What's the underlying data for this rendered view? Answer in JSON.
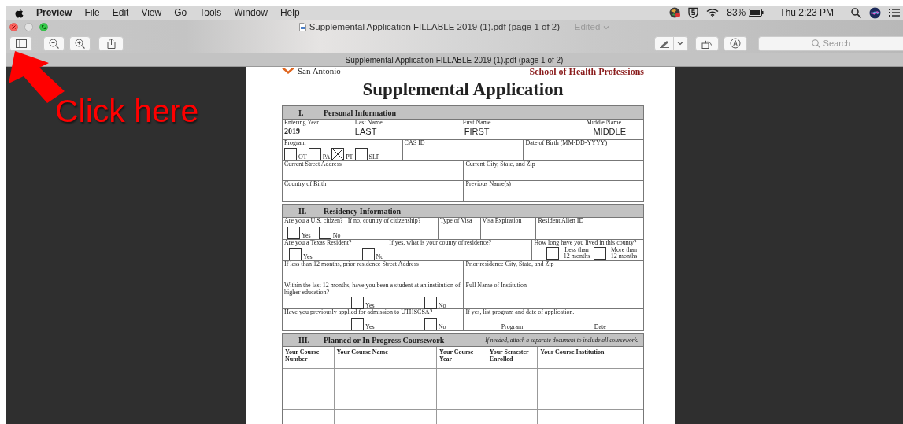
{
  "menu_bar": {
    "app": "Preview",
    "menus": [
      "File",
      "Edit",
      "View",
      "Go",
      "Tools",
      "Window",
      "Help"
    ],
    "battery": "83%",
    "clock": "Thu 2:23 PM"
  },
  "window": {
    "title": "Supplemental Application FILLABLE 2019 (1).pdf (page 1 of 2)",
    "edited": "— Edited",
    "tab_title": "Supplemental Application FILLABLE 2019 (1).pdf (page 1 of 2)"
  },
  "toolbar": {
    "search": {
      "placeholder": "Search"
    }
  },
  "document": {
    "header_left": "San Antonio",
    "header_right": "School of Health Professions",
    "title": "Supplemental Application",
    "sections": [
      {
        "number": "I.",
        "title": "Personal Information",
        "rows": [
          {
            "fields": [
              {
                "label": "Entering Year",
                "value": "2019"
              },
              {
                "label": "Last Name",
                "value": "LAST"
              },
              {
                "label": "First Name",
                "value": "FIRST"
              },
              {
                "label": "Middle Name",
                "value": "MIDDLE"
              }
            ]
          },
          {
            "fields": [
              {
                "label": "Program",
                "options": [
                  {
                    "label": "OT",
                    "checked": false
                  },
                  {
                    "label": "PA",
                    "checked": false
                  },
                  {
                    "label": "PT",
                    "checked": true
                  },
                  {
                    "label": "SLP",
                    "checked": false
                  }
                ]
              },
              {
                "label": "CAS ID"
              },
              {
                "label": "Date of Birth (MM-DD-YYYY)"
              }
            ]
          },
          {
            "fields": [
              {
                "label": "Current Street Address"
              },
              {
                "label": "Current City, State, and Zip"
              }
            ]
          },
          {
            "fields": [
              {
                "label": "Country of Birth"
              },
              {
                "label": "Previous Name(s)"
              }
            ]
          }
        ]
      },
      {
        "number": "II.",
        "title": "Residency Information",
        "rows": [
          {
            "fields": [
              {
                "label": "Are you a U.S. citizen?",
                "options": [
                  {
                    "label": "Yes",
                    "checked": false
                  },
                  {
                    "label": "No",
                    "checked": false
                  }
                ]
              },
              {
                "label": "If no, country of citizenship?"
              },
              {
                "label": "Type of Visa"
              },
              {
                "label": "Visa Expiration"
              },
              {
                "label": "Resident Alien ID"
              }
            ]
          },
          {
            "fields": [
              {
                "label": "Are you a Texas Resident?",
                "options": [
                  {
                    "label": "Yes",
                    "checked": false
                  },
                  {
                    "label": "No",
                    "checked": false
                  }
                ]
              },
              {
                "label": "If yes, what is your county of residence?"
              },
              {
                "label": "How long have you lived in this county?",
                "options": [
                  {
                    "label": "Less than 12 months",
                    "checked": false
                  },
                  {
                    "label": "More than 12 months",
                    "checked": false
                  }
                ]
              }
            ]
          },
          {
            "fields": [
              {
                "label": "If less than 12 months, prior residence Street Address"
              },
              {
                "label": "Prior residence City, State, and Zip"
              }
            ]
          },
          {
            "fields": [
              {
                "label": "Within the last 12 months, have you been a student at an institution of higher education?",
                "options": [
                  {
                    "label": "Yes",
                    "checked": false
                  },
                  {
                    "label": "No",
                    "checked": false
                  }
                ]
              },
              {
                "label": "Full Name of Institution"
              }
            ]
          },
          {
            "fields": [
              {
                "label": "Have you previously applied for admission to UTHSCSA?",
                "options": [
                  {
                    "label": "Yes",
                    "checked": false
                  },
                  {
                    "label": "No",
                    "checked": false
                  }
                ]
              },
              {
                "label": "If yes, list program and date of application.",
                "sublabels": [
                  "Program",
                  "Date"
                ]
              }
            ]
          }
        ]
      },
      {
        "number": "III.",
        "title": "Planned or In Progress Coursework",
        "note": "If needed, attach a separate document to include all coursework.",
        "columns": [
          "Your Course Number",
          "Your Course Name",
          "Your Course Year",
          "Your Semester Enrolled",
          "Your Course Institution"
        ]
      }
    ]
  },
  "annotation": {
    "text": "Click here"
  }
}
